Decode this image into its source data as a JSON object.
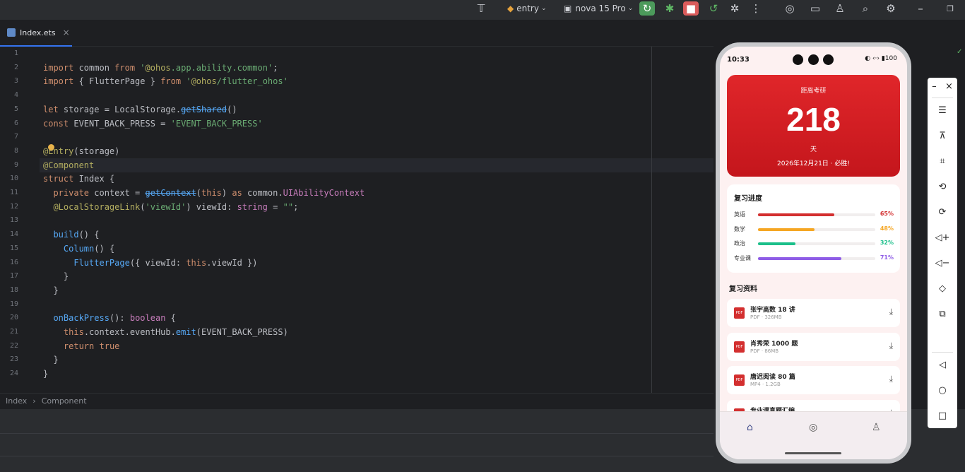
{
  "toolbar": {
    "entry_label": "entry",
    "device_label": "nova 15 Pro"
  },
  "tab": {
    "label": "Index.ets"
  },
  "breadcrumb": {
    "items": [
      "Index",
      "Component"
    ]
  },
  "code_lines": [
    "",
    "import common from '@ohos.app.ability.common';",
    "import { FlutterPage } from '@ohos/flutter_ohos'",
    "",
    "let storage = LocalStorage.getShared()",
    "const EVENT_BACK_PRESS = 'EVENT_BACK_PRESS'",
    "",
    "@Entry(storage)",
    "@Component",
    "struct Index {",
    "  private context = getContext(this) as common.UIAbilityContext",
    "  @LocalStorageLink('viewId') viewId: string = \"\";",
    "",
    "  build() {",
    "    Column() {",
    "      FlutterPage({ viewId: this.viewId })",
    "    }",
    "  }",
    "",
    "  onBackPress(): boolean {",
    "    this.context.eventHub.emit(EVENT_BACK_PRESS)",
    "    return true",
    "  }",
    "}"
  ],
  "phone": {
    "status_time": "10:33",
    "status_icons": "◐ ‹·› ▮100",
    "hero": {
      "label": "距离考研",
      "days": "218",
      "unit": "天",
      "date": "2026年12月21日 · 必胜!"
    },
    "progress": {
      "title": "复习进度",
      "items": [
        {
          "label": "英语",
          "pct": "65%",
          "value": 0.65,
          "color": "#d32f2f"
        },
        {
          "label": "数学",
          "pct": "48%",
          "value": 0.48,
          "color": "#f5a623"
        },
        {
          "label": "政治",
          "pct": "32%",
          "value": 0.32,
          "color": "#1bbf8a"
        },
        {
          "label": "专业课",
          "pct": "71%",
          "value": 0.71,
          "color": "#8e5ce6"
        }
      ]
    },
    "resources": {
      "title": "复习资料",
      "items": [
        {
          "title": "张宇高数 18 讲",
          "meta": "PDF · 326MB"
        },
        {
          "title": "肖秀荣 1000 题",
          "meta": "PDF · 86MB"
        },
        {
          "title": "唐迟阅读 80 篇",
          "meta": "MP4 · 1.2GB"
        },
        {
          "title": "专业课真题汇编",
          "meta": ""
        }
      ]
    }
  },
  "colors": {
    "accent": "#3574f0",
    "hero_red": "#d32f2f",
    "nav_blue": "#3f4a8a"
  }
}
